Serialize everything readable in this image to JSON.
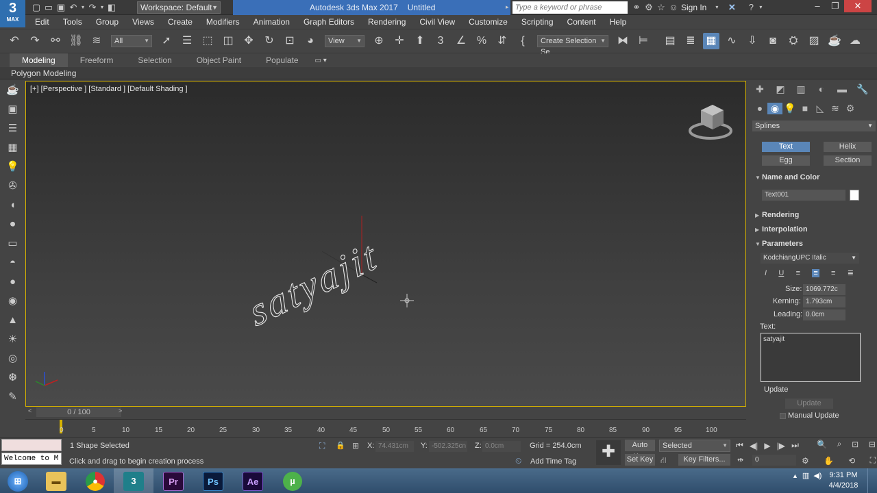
{
  "app": {
    "logo_number": "3",
    "logo_label": "MAX",
    "title": "Autodesk 3ds Max 2017",
    "document": "Untitled"
  },
  "workspace": {
    "label": "Workspace: Default"
  },
  "search": {
    "placeholder": "Type a keyword or phrase"
  },
  "account": {
    "sign_in": "Sign In"
  },
  "menu": [
    "Edit",
    "Tools",
    "Group",
    "Views",
    "Create",
    "Modifiers",
    "Animation",
    "Graph Editors",
    "Rendering",
    "Civil View",
    "Customize",
    "Scripting",
    "Content",
    "Help"
  ],
  "toolbar": {
    "filter": "All",
    "ref_coord": "View",
    "selection_set": "Create Selection Se"
  },
  "ribbon": {
    "tabs": [
      "Modeling",
      "Freeform",
      "Selection",
      "Object Paint",
      "Populate"
    ],
    "sub": "Polygon Modeling"
  },
  "viewport": {
    "label": "[+] [Perspective ] [Standard ] [Default Shading ]",
    "text_object": "satyajit"
  },
  "command_panel": {
    "category": "Splines",
    "buttons": [
      "Text",
      "Helix",
      "Egg",
      "Section"
    ],
    "name_and_color": {
      "title": "Name and Color",
      "name": "Text001",
      "color": "#ffffff"
    },
    "rollouts": [
      "Rendering",
      "Interpolation"
    ],
    "parameters": {
      "title": "Parameters",
      "font": "KodchiangUPC Italic",
      "size_label": "Size:",
      "size": "1069.772c",
      "kerning_label": "Kerning:",
      "kerning": "1.793cm",
      "leading_label": "Leading:",
      "leading": "0.0cm",
      "text_label": "Text:",
      "text": "satyajit",
      "update_title": "Update",
      "update_button": "Update",
      "manual_update": "Manual Update"
    }
  },
  "timeline": {
    "frame": "0 / 100",
    "ticks": [
      "0",
      "5",
      "10",
      "15",
      "20",
      "25",
      "30",
      "35",
      "40",
      "45",
      "50",
      "55",
      "60",
      "65",
      "70",
      "75",
      "80",
      "85",
      "90",
      "95",
      "100"
    ]
  },
  "status": {
    "maxscript": "Welcome to M",
    "selected": "1 Shape Selected",
    "prompt": "Click and drag to begin creation process",
    "x_label": "X:",
    "x": "74.431cm",
    "y_label": "Y:",
    "y": "-502.325cn",
    "z_label": "Z:",
    "z": "0.0cm",
    "grid": "Grid = 254.0cm",
    "add_time_tag": "Add Time Tag",
    "auto_key": "Auto Key",
    "set_key": "Set Key",
    "selected_dd": "Selected",
    "key_filters": "Key Filters...",
    "frame_field": "0"
  },
  "taskbar": {
    "time": "9:31 PM",
    "date": "4/4/2018",
    "apps": [
      "chrome",
      "3ds Max",
      "Pr",
      "Ps",
      "Ae",
      "uTorrent"
    ]
  }
}
